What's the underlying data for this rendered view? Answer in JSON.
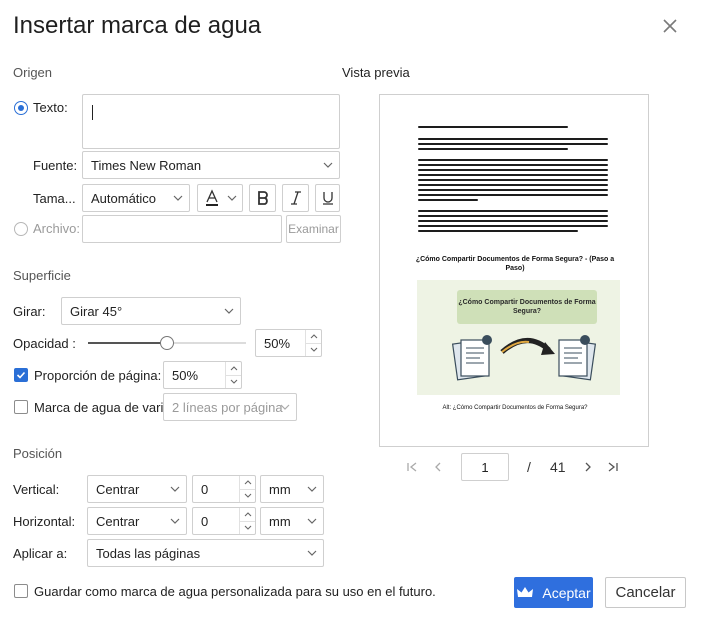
{
  "dialog": {
    "title": "Insertar marca de agua"
  },
  "origin": {
    "section_label": "Origen",
    "text_radio_label": "Texto:",
    "text_value": "",
    "font_label": "Fuente:",
    "font_value": "Times New Roman",
    "size_label": "Tama...",
    "size_value": "Automático",
    "file_radio_label": "Archivo:",
    "file_value": "",
    "browse_label": "Examinar"
  },
  "surface": {
    "section_label": "Superficie",
    "rotate_label": "Girar:",
    "rotate_value": "Girar 45°",
    "opacity_label": "Opacidad :",
    "opacity_value": "50%",
    "opacity_level": 0.5,
    "page_ratio_label": "Proporción de página:",
    "page_ratio_value": "50%",
    "page_ratio_checked": true,
    "multi_label": "Marca de agua de vari...",
    "multi_value": "2 líneas por página",
    "multi_checked": false
  },
  "position": {
    "section_label": "Posición",
    "vertical_label": "Vertical:",
    "vertical_align": "Centrar",
    "vertical_offset": "0",
    "vertical_unit": "mm",
    "horizontal_label": "Horizontal:",
    "horizontal_align": "Centrar",
    "horizontal_offset": "0",
    "horizontal_unit": "mm",
    "apply_label": "Aplicar a:",
    "apply_value": "Todas las páginas"
  },
  "preview": {
    "label": "Vista previa",
    "doc_heading": "¿Cómo Compartir Documentos de Forma Segura? - (Paso a Paso)",
    "banner_title": "¿Cómo Compartir Documentos de Forma Segura?",
    "caption": "Alt: ¿Cómo Compartir Documentos de Forma Segura?",
    "current_page": "1",
    "separator": "/",
    "total_pages": "41"
  },
  "footer": {
    "save_custom_label": "Guardar como marca de agua personalizada para su uso en el futuro.",
    "accept_label": "Aceptar",
    "cancel_label": "Cancelar"
  },
  "colors": {
    "accent": "#2f6fde",
    "banner_bg": "#eef3e4",
    "banner_title_bg": "#cfe0b8"
  }
}
